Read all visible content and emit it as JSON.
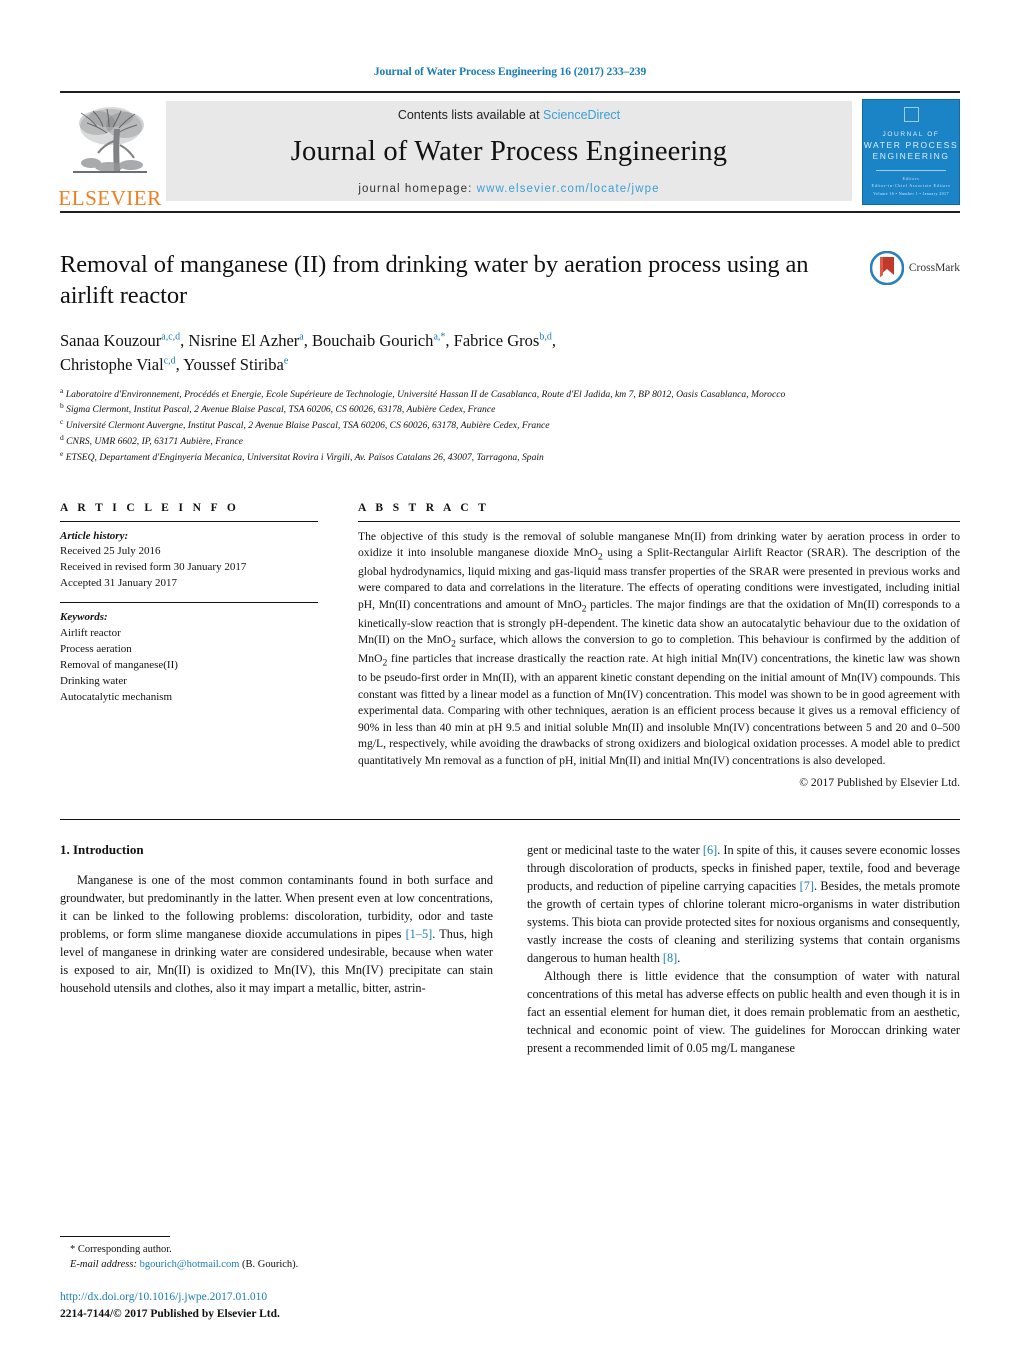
{
  "running_head": "Journal of Water Process Engineering 16 (2017) 233–239",
  "masthead": {
    "elsevier_wordmark": "ELSEVIER",
    "contents_prefix": "Contents lists available at ",
    "contents_link": "ScienceDirect",
    "journal_name": "Journal of Water Process Engineering",
    "homepage_prefix": "journal homepage: ",
    "homepage_url": "www.elsevier.com/locate/jwpe",
    "cover": {
      "line1": "JOURNAL OF",
      "line2": "WATER PROCESS",
      "line3": "ENGINEERING",
      "editors_label": "Editors",
      "editors": "Editor-in-Chief   Associate Editors",
      "footer": "Volume 16 • Number 1 • January 2017"
    }
  },
  "article": {
    "title": "Removal of manganese (II) from drinking water by aeration process using an airlift reactor",
    "crossmark_label": "CrossMark",
    "authors_line1_a": "Sanaa Kouzour",
    "authors_line1_a_sup": "a,c,d",
    "authors_line1_b": ", Nisrine El Azher",
    "authors_line1_b_sup": "a",
    "authors_line1_c": ", Bouchaib Gourich",
    "authors_line1_c_sup": "a,*",
    "authors_line1_d": ", Fabrice Gros",
    "authors_line1_d_sup": "b,d",
    "authors_line1_e": ",",
    "authors_line2_a": "Christophe Vial",
    "authors_line2_a_sup": "c,d",
    "authors_line2_b": ", Youssef Stiriba",
    "authors_line2_b_sup": "e",
    "affiliations": [
      {
        "mark": "a",
        "text": "Laboratoire d'Environnement, Procédés et Energie, Ecole Supérieure de Technologie, Université Hassan II de Casablanca, Route d'El Jadida, km 7, BP 8012, Oasis Casablanca, Morocco"
      },
      {
        "mark": "b",
        "text": "Sigma Clermont, Institut Pascal, 2 Avenue Blaise Pascal, TSA 60206, CS 60026, 63178, Aubière Cedex, France"
      },
      {
        "mark": "c",
        "text": "Université Clermont Auvergne, Institut Pascal, 2 Avenue Blaise Pascal, TSA 60206, CS 60026, 63178, Aubière Cedex, France"
      },
      {
        "mark": "d",
        "text": "CNRS, UMR 6602, IP, 63171 Aubière, France"
      },
      {
        "mark": "e",
        "text": "ETSEQ, Departament d'Enginyeria Mecanica, Universitat Rovira i Virgili, Av. Països Catalans 26, 43007, Tarragona, Spain"
      }
    ]
  },
  "article_info": {
    "heading": "A R T I C L E   I N F O",
    "history_label": "Article history:",
    "history": [
      "Received 25 July 2016",
      "Received in revised form 30 January 2017",
      "Accepted 31 January 2017"
    ],
    "keywords_label": "Keywords:",
    "keywords": [
      "Airlift reactor",
      "Process aeration",
      "Removal of manganese(II)",
      "Drinking water",
      "Autocatalytic mechanism"
    ]
  },
  "abstract": {
    "heading": "A B S T R A C T",
    "body": "The objective of this study is the removal of soluble manganese Mn(II) from drinking water by aeration process in order to oxidize it into insoluble manganese dioxide MnO2 using a Split-Rectangular Airlift Reactor (SRAR). The description of the global hydrodynamics, liquid mixing and gas-liquid mass transfer properties of the SRAR were presented in previous works and were compared to data and correlations in the literature. The effects of operating conditions were investigated, including initial pH, Mn(II) concentrations and amount of MnO2 particles. The major findings are that the oxidation of Mn(II) corresponds to a kinetically-slow reaction that is strongly pH-dependent. The kinetic data show an autocatalytic behaviour due to the oxidation of Mn(II) on the MnO2 surface, which allows the conversion to go to completion. This behaviour is confirmed by the addition of MnO2 fine particles that increase drastically the reaction rate. At high initial Mn(IV) concentrations, the kinetic law was shown to be pseudo-first order in Mn(II), with an apparent kinetic constant depending on the initial amount of Mn(IV) compounds. This constant was fitted by a linear model as a function of Mn(IV) concentration. This model was shown to be in good agreement with experimental data. Comparing with other techniques, aeration is an efficient process because it gives us a removal efficiency of 90% in less than 40 min at pH 9.5 and initial soluble Mn(II) and insoluble Mn(IV) concentrations between 5 and 20 and 0–500 mg/L, respectively, while avoiding the drawbacks of strong oxidizers and biological oxidation processes. A model able to predict quantitatively Mn removal as a function of pH, initial Mn(II) and initial Mn(IV) concentrations is also developed.",
    "copyright": "© 2017 Published by Elsevier Ltd."
  },
  "introduction": {
    "heading": "1. Introduction",
    "left_paragraph_part1": "Manganese is one of the most common contaminants found in both surface and groundwater, but predominantly in the latter. When present even at low concentrations, it can be linked to the following problems: discoloration, turbidity, odor and taste problems, or form slime manganese dioxide accumulations in pipes ",
    "left_ref1": "[1–5]",
    "left_paragraph_part2": ". Thus, high level of manganese in drinking water are considered undesirable, because when water is exposed to air, Mn(II) is oxidized to Mn(IV), this Mn(IV) precipitate can stain household utensils and clothes, also it may impart a metallic, bitter, astrin-",
    "right_p1_part1": "gent or medicinal taste to the water ",
    "right_ref6": "[6]",
    "right_p1_part2": ". In spite of this, it causes severe economic losses through discoloration of products, specks in finished paper, textile, food and beverage products, and reduction of pipeline carrying capacities ",
    "right_ref7": "[7]",
    "right_p1_part3": ". Besides, the metals promote the growth of certain types of chlorine tolerant micro-organisms in water distribution systems. This biota can provide protected sites for noxious organisms and consequently, vastly increase the costs of cleaning and sterilizing systems that contain organisms dangerous to human health ",
    "right_ref8": "[8]",
    "right_p1_part4": ".",
    "right_p2": "Although there is little evidence that the consumption of water with natural concentrations of this metal has adverse effects on public health and even though it is in fact an essential element for human diet, it does remain problematic from an aesthetic, technical and economic point of view. The guidelines for Moroccan drinking water present a recommended limit of 0.05 mg/L manganese"
  },
  "footer": {
    "corresponding_mark": "*",
    "corresponding_text": " Corresponding author.",
    "email_label": "E-mail address:",
    "email": "bgourich@hotmail.com",
    "email_suffix": " (B. Gourich).",
    "doi": "http://dx.doi.org/10.1016/j.jwpe.2017.01.010",
    "issn": "2214-7144/© 2017 Published by Elsevier Ltd."
  },
  "colors": {
    "link_blue": "#1a7db6",
    "sciencedirect_blue": "#3a9fd6",
    "elsevier_orange": "#ef7d22",
    "cover_blue": "#1a84c7"
  }
}
